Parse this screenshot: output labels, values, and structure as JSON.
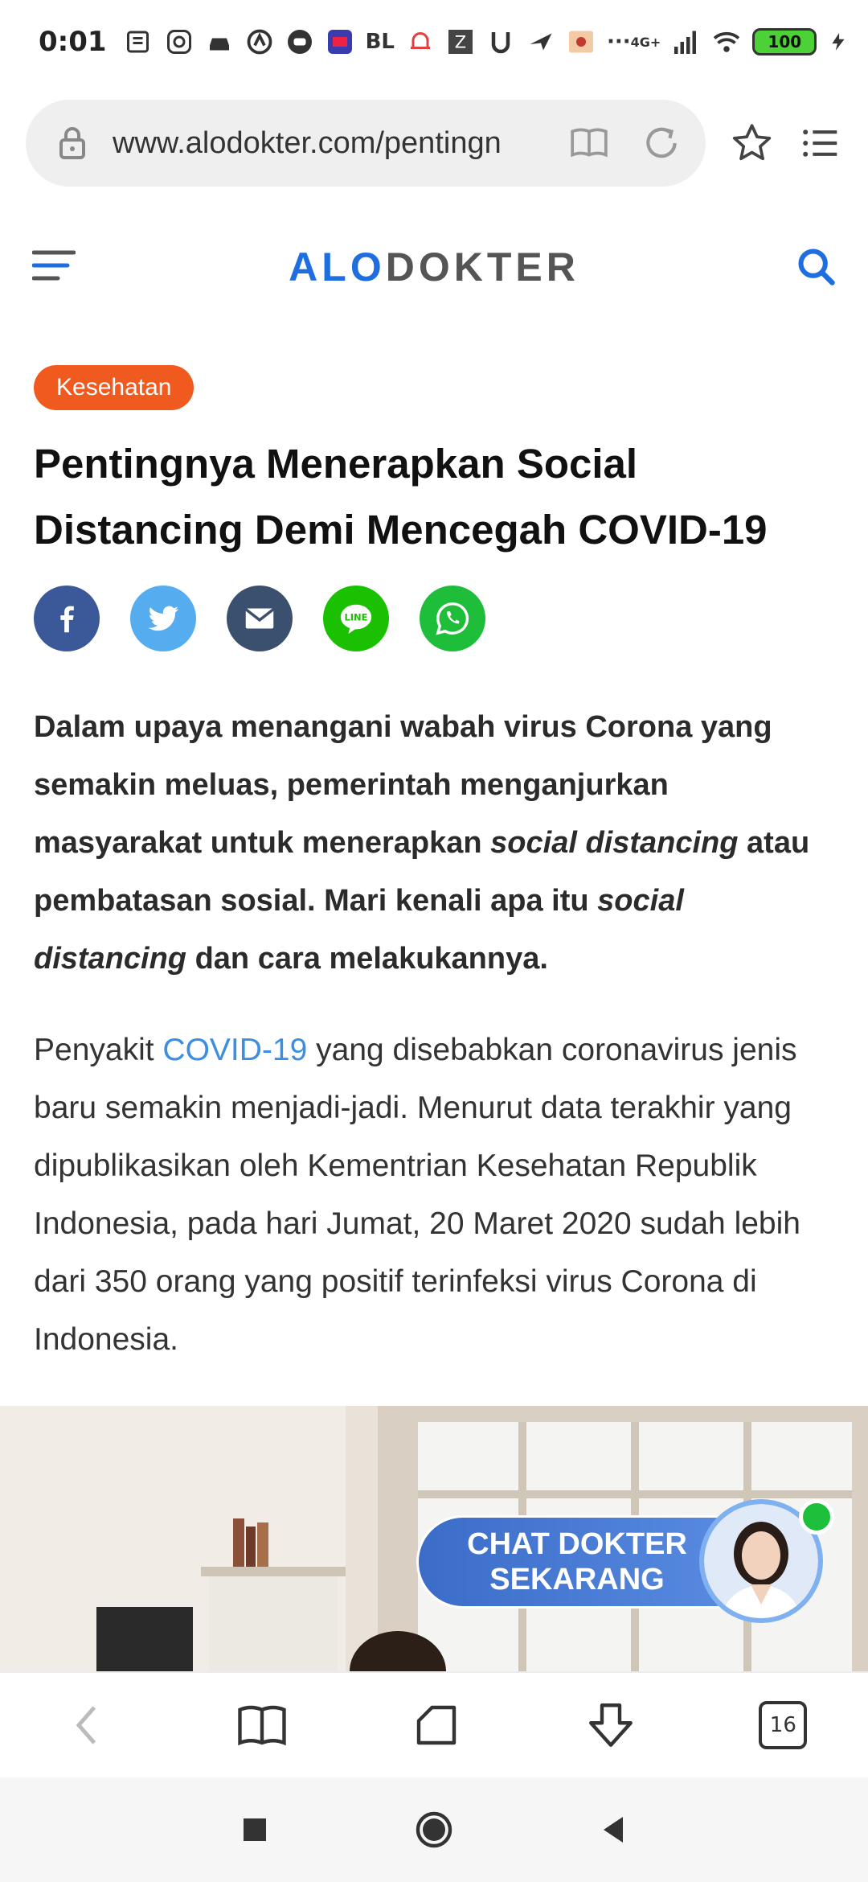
{
  "status_bar": {
    "time": "0:01",
    "carrier_text": "BL",
    "network": "4G+",
    "battery": "100"
  },
  "browser": {
    "url": "www.alodokter.com/pentingn",
    "tab_count": "16"
  },
  "site": {
    "logo_part1": "ALO",
    "logo_part2": "DOKTER"
  },
  "article": {
    "category": "Kesehatan",
    "title": "Pentingnya Menerapkan Social Distancing Demi Mencegah COVID-19",
    "lead_1": "Dalam upaya menangani wabah virus Corona yang semakin meluas, pemerintah menganjurkan masyarakat untuk menerapkan ",
    "lead_em1": "social distancing",
    "lead_2": " atau pembatasan sosial. Mari kenali apa itu ",
    "lead_em2": "social distancing",
    "lead_3": " dan cara melakukannya.",
    "body_1": "Penyakit ",
    "body_link": "COVID-19",
    "body_2": " yang disebabkan coronavirus jenis baru semakin menjadi-jadi. Menurut data terakhir yang dipublikasikan oleh Kementrian Kesehatan Republik Indonesia, pada hari Jumat, 20 Maret 2020 sudah lebih dari 350 orang yang positif terinfeksi virus Corona di Indonesia."
  },
  "chat_cta": {
    "line1": "CHAT DOKTER",
    "line2": "SEKARANG"
  },
  "colors": {
    "brand_blue": "#1e6ee0",
    "badge_orange": "#f05a1e",
    "link_blue": "#3c8fe0",
    "facebook": "#3b5998",
    "twitter": "#55acee",
    "email": "#3b4f6e",
    "line": "#19c100",
    "whatsapp": "#1ebe3a"
  },
  "icons": [
    "lock-icon",
    "reader-mode-icon",
    "reload-icon",
    "star-icon",
    "list-icon",
    "menu-icon",
    "search-icon",
    "facebook-icon",
    "twitter-icon",
    "email-icon",
    "line-icon",
    "whatsapp-icon",
    "back-icon",
    "bookmarks-icon",
    "home-icon",
    "download-icon",
    "recents-icon",
    "nav-home-icon",
    "nav-back-icon"
  ]
}
